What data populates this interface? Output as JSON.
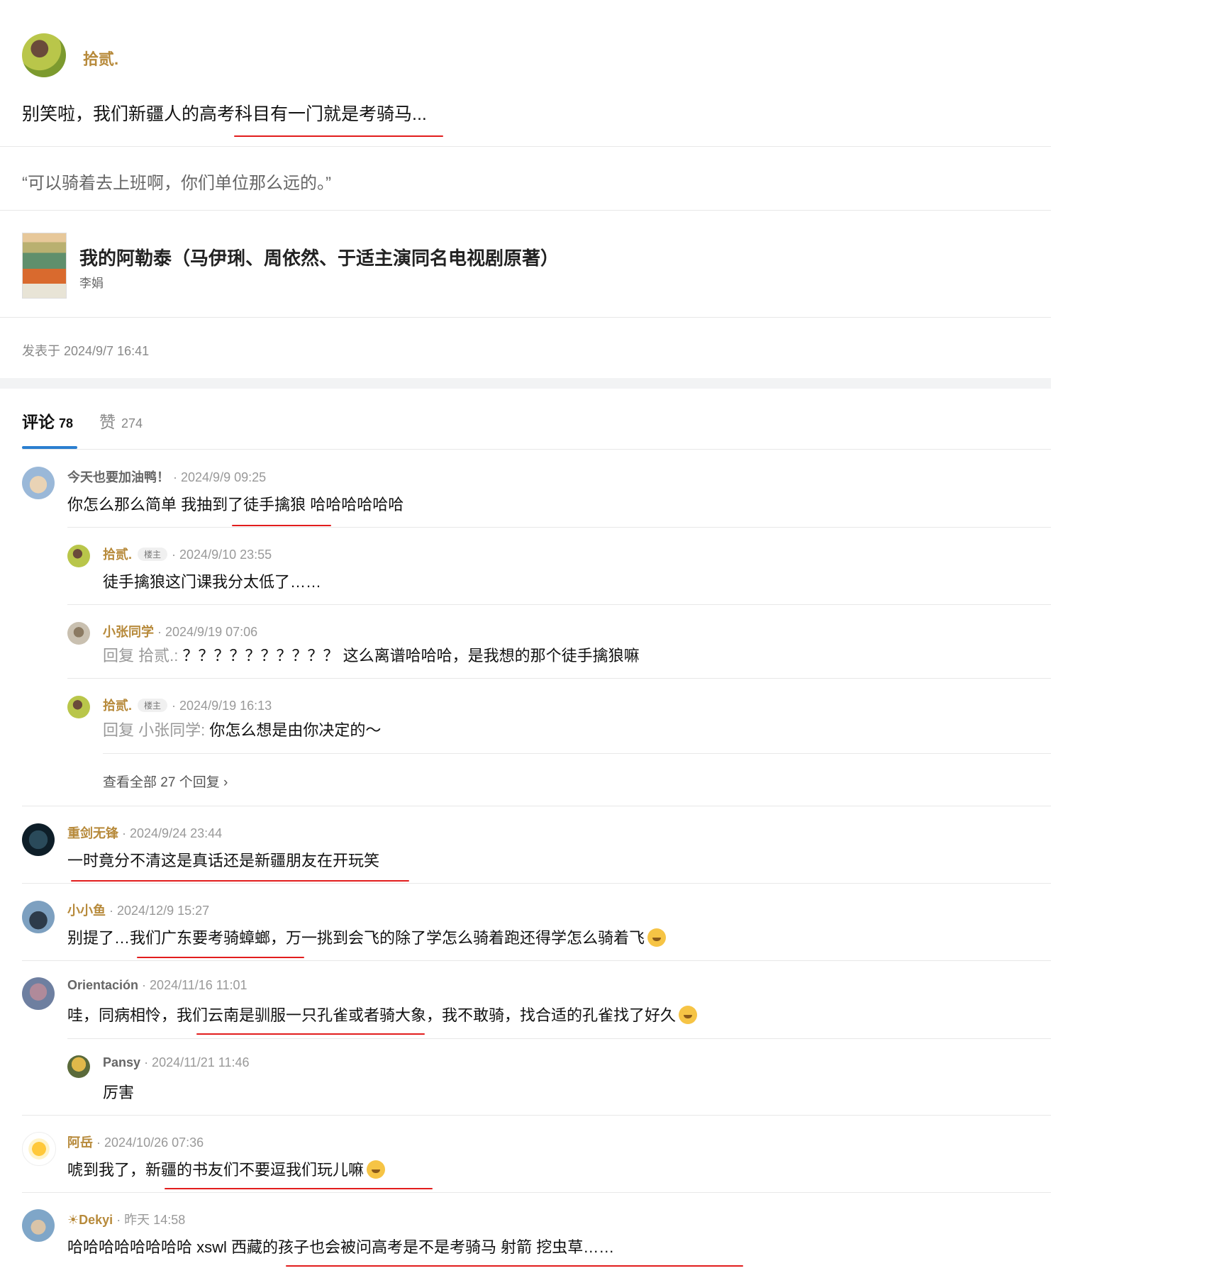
{
  "post": {
    "author": "拾贰.",
    "text": "别笑啦，我们新疆人的高考科目有一门就是考骑马...",
    "quote": "“可以骑着去上班啊，你们单位那么远的。”",
    "book": {
      "title": "我的阿勒泰（马伊琍、周依然、于适主演同名电视剧原著）",
      "author": "李娟"
    },
    "published": "发表于 2024/9/7 16:41"
  },
  "tabs": {
    "comments_label": "评论",
    "comments_count": "78",
    "likes_label": "赞",
    "likes_count": "274"
  },
  "comments": [
    {
      "name": "今天也要加油鸭！",
      "time": "· 2024/9/9 09:25",
      "text": "你怎么那么简单 我抽到了徒手擒狼 哈哈哈哈哈哈"
    },
    {
      "name": "拾贰.",
      "badge": "楼主",
      "time": "· 2024/9/10 23:55",
      "text": "徒手擒狼这门课我分太低了……"
    },
    {
      "name": "小张同学",
      "time": "· 2024/9/19 07:06",
      "prefix": "回复 拾贰.: ",
      "text": "？？？？？？？？？？ 这么离谱哈哈哈，是我想的那个徒手擒狼嘛"
    },
    {
      "name": "拾贰.",
      "badge": "楼主",
      "time": "· 2024/9/19 16:13",
      "prefix": "回复 小张同学: ",
      "text": "你怎么想是由你决定的～"
    },
    {
      "name": "重剑无锋",
      "time": "· 2024/9/24 23:44",
      "text": "一时竟分不清这是真话还是新疆朋友在开玩笑"
    },
    {
      "name": "小小鱼",
      "time": "· 2024/12/9 15:27",
      "text": "别提了…我们广东要考骑蟑螂，万一挑到会飞的除了学怎么骑着跑还得学怎么骑着飞"
    },
    {
      "name": "Orientación",
      "time": "· 2024/11/16 11:01",
      "text": "哇，同病相怜，我们云南是驯服一只孔雀或者骑大象，我不敢骑，找合适的孔雀找了好久"
    },
    {
      "name": "Pansy",
      "time": "· 2024/11/21 11:46",
      "text": "厉害"
    },
    {
      "name": "阿岳",
      "time": "· 2024/10/26 07:36",
      "text": "唬到我了，新疆的书友们不要逗我们玩儿嘛"
    },
    {
      "name": "☀Dekyi",
      "time": "· 昨天 14:58",
      "text": "哈哈哈哈哈哈哈哈 xswl 西藏的孩子也会被问高考是不是考骑马 射箭 挖虫草……"
    }
  ],
  "view_all_replies": "查看全部 27 个回复 ›",
  "colors": {
    "author": "#b78a3b",
    "tab_accent": "#2b7fd0",
    "annotation": "#e21d1d"
  }
}
